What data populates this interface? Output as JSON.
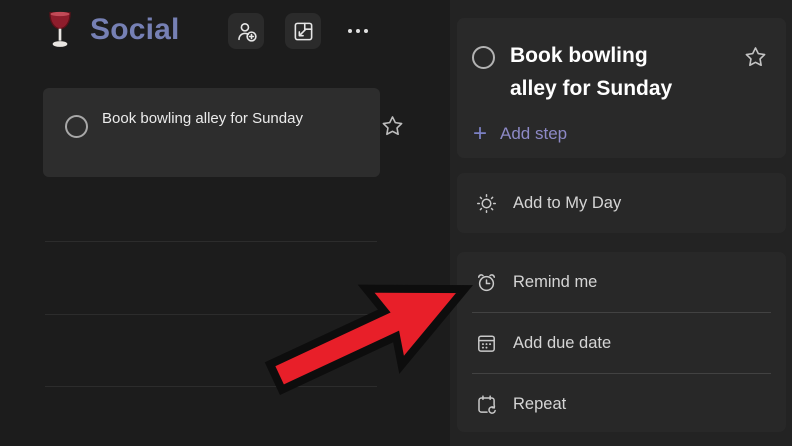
{
  "list": {
    "icon": "wine-glass-icon",
    "title": "Social",
    "header_icons": [
      "share-list-icon",
      "popout-icon",
      "more-options-icon"
    ],
    "tasks": [
      {
        "title": "Book bowling alley for Sunday",
        "completed": false,
        "starred": false
      }
    ]
  },
  "detail": {
    "title": "Book bowling alley for Sunday",
    "completed": false,
    "starred": false,
    "add_step_label": "Add step",
    "actions": [
      {
        "label": "Add to My Day",
        "icon": "sun-icon"
      },
      {
        "label": "Remind me",
        "icon": "alarm-clock-icon"
      },
      {
        "label": "Add due date",
        "icon": "calendar-icon"
      },
      {
        "label": "Repeat",
        "icon": "repeat-icon"
      }
    ]
  },
  "annotation": {
    "arrow_fill": "#e81f29",
    "arrow_outline": "#0d0d0d",
    "points_to": "Remind me"
  },
  "colors": {
    "left_panel_bg": "#1c1c1c",
    "right_panel_bg": "#232323",
    "task_card_bg": "#2d2d2d",
    "detail_card_bg": "#292929",
    "action_card_bg": "#282828",
    "list_title": "#7680b4",
    "accent_purple": "#8d89c6"
  }
}
